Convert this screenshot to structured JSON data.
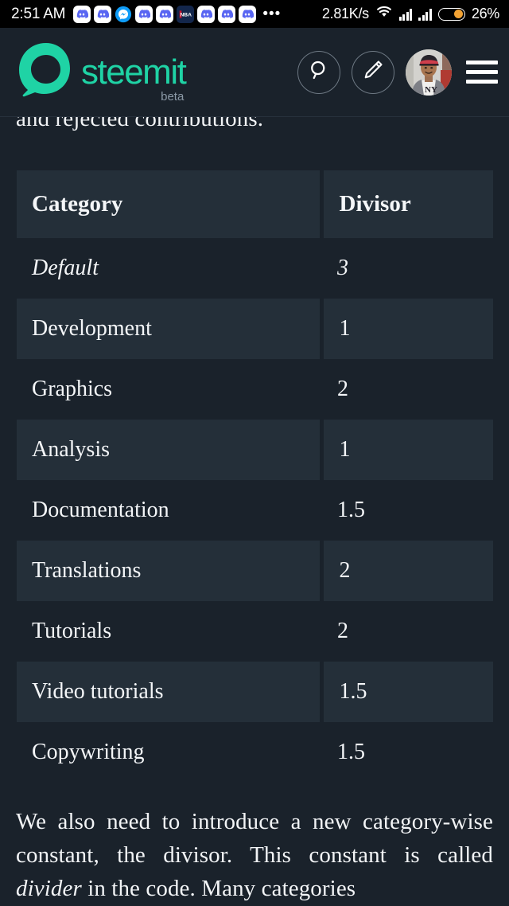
{
  "statusbar": {
    "time": "2:51 AM",
    "notification_icons": [
      {
        "name": "discord-icon",
        "type": "discord"
      },
      {
        "name": "discord-icon",
        "type": "discord"
      },
      {
        "name": "messenger-icon",
        "type": "messenger"
      },
      {
        "name": "discord-icon",
        "type": "discord"
      },
      {
        "name": "discord-icon",
        "type": "discord"
      },
      {
        "name": "nba-icon",
        "type": "nba"
      },
      {
        "name": "discord-icon",
        "type": "discord"
      },
      {
        "name": "discord-icon",
        "type": "discord"
      },
      {
        "name": "discord-icon",
        "type": "discord"
      }
    ],
    "overflow": "•••",
    "network_speed": "2.81K/s",
    "battery_percent": "26%",
    "colors": {
      "background": "#000000",
      "text": "#ffffff",
      "battery_fill": "#f2a233",
      "discord_blurple": "#5865f2",
      "messenger_blue": "#0e9cf8",
      "nba_navy": "#13264b",
      "nba_red": "#c8102e"
    }
  },
  "appbar": {
    "brand_name": "steemit",
    "brand_sub": "beta",
    "search_icon": "search-icon",
    "compose_icon": "pencil-icon",
    "avatar_label": "user-avatar",
    "menu_icon": "hamburger-menu-icon",
    "colors": {
      "brand_green": "#1fd3a5",
      "background": "#1a222b",
      "icon_outline": "#6d7883",
      "beta_text": "#8b99a6"
    }
  },
  "content": {
    "paragraph_top": "and rejected contributions.",
    "table": {
      "headers": [
        "Category",
        "Divisor"
      ],
      "rows": [
        {
          "category": "Default",
          "divisor": "3",
          "italic": true
        },
        {
          "category": "Development",
          "divisor": "1",
          "italic": false
        },
        {
          "category": "Graphics",
          "divisor": "2",
          "italic": false
        },
        {
          "category": "Analysis",
          "divisor": "1",
          "italic": false
        },
        {
          "category": "Documentation",
          "divisor": "1.5",
          "italic": false
        },
        {
          "category": "Translations",
          "divisor": "2",
          "italic": false
        },
        {
          "category": "Tutorials",
          "divisor": "2",
          "italic": false
        },
        {
          "category": "Video tutorials",
          "divisor": "1.5",
          "italic": false
        },
        {
          "category": "Copywriting",
          "divisor": "1.5",
          "italic": false
        }
      ]
    },
    "paragraph_bottom_part1": "We also need to introduce a new category-wise constant, the divisor. This constant is called ",
    "paragraph_bottom_em": "divider",
    "paragraph_bottom_part2": " in the code. Many categories",
    "colors": {
      "page_background": "#1a222b",
      "row_stripe": "#242f39",
      "text": "#f2f4f6"
    }
  }
}
